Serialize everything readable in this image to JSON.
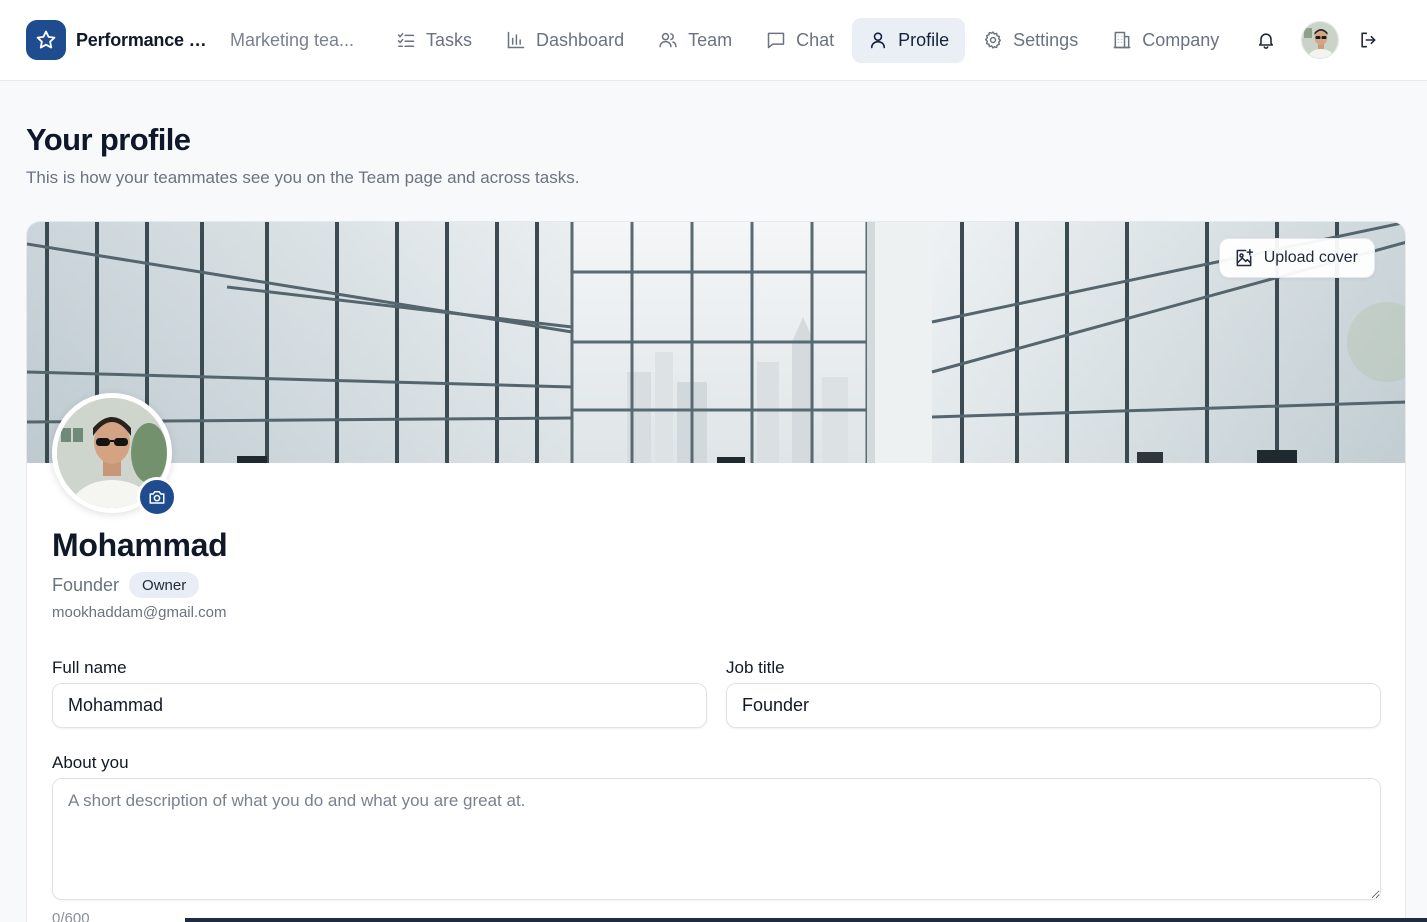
{
  "app": {
    "name": "Performance St...",
    "workspace": "Marketing tea..."
  },
  "nav": {
    "items": [
      {
        "label": "Tasks",
        "icon": "tasks-icon"
      },
      {
        "label": "Dashboard",
        "icon": "bar-chart-icon"
      },
      {
        "label": "Team",
        "icon": "users-icon"
      },
      {
        "label": "Chat",
        "icon": "chat-icon"
      },
      {
        "label": "Profile",
        "icon": "user-icon",
        "active": true
      },
      {
        "label": "Settings",
        "icon": "gear-icon"
      },
      {
        "label": "Company",
        "icon": "building-icon"
      }
    ]
  },
  "page": {
    "title": "Your profile",
    "subtitle": "This is how your teammates see you on the Team page and across tasks."
  },
  "cover": {
    "upload_label": "Upload cover"
  },
  "profile": {
    "name": "Mohammad",
    "role": "Founder",
    "badge": "Owner",
    "email": "mookhaddam@gmail.com"
  },
  "form": {
    "full_name_label": "Full name",
    "full_name_value": "Mohammad",
    "job_title_label": "Job title",
    "job_title_value": "Founder",
    "about_label": "About you",
    "about_placeholder": "A short description of what you do and what you are great at.",
    "about_value": "",
    "char_count": "0/600"
  },
  "colors": {
    "brand": "#1f4b8f",
    "active_nav_bg": "#eaeff6",
    "page_bg": "#f8f9fb"
  }
}
